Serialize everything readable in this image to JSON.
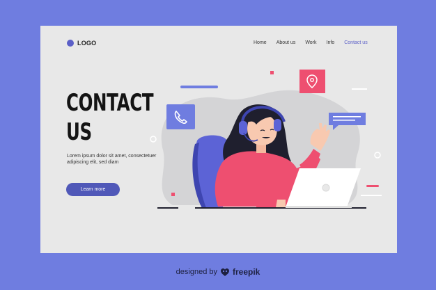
{
  "logo": {
    "text": "LOGO"
  },
  "nav": {
    "items": [
      "Home",
      "About us",
      "Work",
      "Info",
      "Contact us"
    ]
  },
  "hero": {
    "title_line1": "CONTACT",
    "title_line2": "US",
    "description": "Lorem ipsum dolor sit amet, consectetuer adipiscing elit, sed diam",
    "button_label": "Learn more"
  },
  "footer": {
    "prefix": "designed by",
    "brand": "freepik"
  },
  "colors": {
    "background": "#6f7de0",
    "card": "#e8e8e8",
    "accent": "#5b5fc7",
    "pink": "#ee4f70"
  },
  "icons": [
    "phone-icon",
    "location-pin-icon",
    "chat-bubble-icon",
    "freepik-logo-icon"
  ]
}
